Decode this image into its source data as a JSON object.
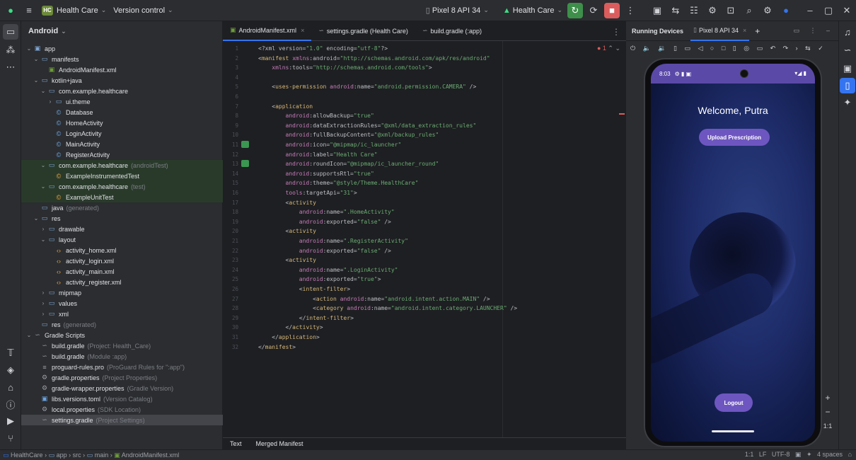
{
  "titlebar": {
    "project_badge": "HC",
    "project_name": "Health Care",
    "vcs": "Version control",
    "device": "Pixel 8 API 34",
    "run_config": "Health Care"
  },
  "project_panel": {
    "view": "Android",
    "tree": [
      {
        "label": "app",
        "dim": ""
      },
      {
        "label": "manifests",
        "dim": ""
      },
      {
        "label": "AndroidManifest.xml",
        "dim": ""
      },
      {
        "label": "kotlin+java",
        "dim": ""
      },
      {
        "label": "com.example.healthcare",
        "dim": ""
      },
      {
        "label": "ui.theme",
        "dim": ""
      },
      {
        "label": "Database",
        "dim": ""
      },
      {
        "label": "HomeActivity",
        "dim": ""
      },
      {
        "label": "LoginActivity",
        "dim": ""
      },
      {
        "label": "MainActivity",
        "dim": ""
      },
      {
        "label": "RegisterActivity",
        "dim": ""
      },
      {
        "label": "com.example.healthcare",
        "dim": "(androidTest)"
      },
      {
        "label": "ExampleInstrumentedTest",
        "dim": ""
      },
      {
        "label": "com.example.healthcare",
        "dim": "(test)"
      },
      {
        "label": "ExampleUnitTest",
        "dim": ""
      },
      {
        "label": "java",
        "dim": "(generated)"
      },
      {
        "label": "res",
        "dim": ""
      },
      {
        "label": "drawable",
        "dim": ""
      },
      {
        "label": "layout",
        "dim": ""
      },
      {
        "label": "activity_home.xml",
        "dim": ""
      },
      {
        "label": "activity_login.xml",
        "dim": ""
      },
      {
        "label": "activity_main.xml",
        "dim": ""
      },
      {
        "label": "activity_register.xml",
        "dim": ""
      },
      {
        "label": "mipmap",
        "dim": ""
      },
      {
        "label": "values",
        "dim": ""
      },
      {
        "label": "xml",
        "dim": ""
      },
      {
        "label": "res",
        "dim": "(generated)"
      },
      {
        "label": "Gradle Scripts",
        "dim": ""
      },
      {
        "label": "build.gradle",
        "dim": "(Project: Health_Care)"
      },
      {
        "label": "build.gradle",
        "dim": "(Module :app)"
      },
      {
        "label": "proguard-rules.pro",
        "dim": "(ProGuard Rules for \":app\")"
      },
      {
        "label": "gradle.properties",
        "dim": "(Project Properties)"
      },
      {
        "label": "gradle-wrapper.properties",
        "dim": "(Gradle Version)"
      },
      {
        "label": "libs.versions.toml",
        "dim": "(Version Catalog)"
      },
      {
        "label": "local.properties",
        "dim": "(SDK Location)"
      },
      {
        "label": "settings.gradle",
        "dim": "(Project Settings)"
      }
    ]
  },
  "editor": {
    "tabs": [
      {
        "label": "AndroidManifest.xml"
      },
      {
        "label": "settings.gradle (Health Care)"
      },
      {
        "label": "build.gradle (:app)"
      }
    ],
    "error_indicator": "1",
    "code": [
      "<?xml version=\"1.0\" encoding=\"utf-8\"?>",
      "<manifest xmlns:android=\"http://schemas.android.com/apk/res/android\"",
      "    xmlns:tools=\"http://schemas.android.com/tools\">",
      "",
      "    <uses-permission android:name=\"android.permission.CAMERA\" />",
      "",
      "    <application",
      "        android:allowBackup=\"true\"",
      "        android:dataExtractionRules=\"@xml/data_extraction_rules\"",
      "        android:fullBackupContent=\"@xml/backup_rules\"",
      "        android:icon=\"@mipmap/ic_launcher\"",
      "        android:label=\"Health Care\"",
      "        android:roundIcon=\"@mipmap/ic_launcher_round\"",
      "        android:supportsRtl=\"true\"",
      "        android:theme=\"@style/Theme.HealthCare\"",
      "        tools:targetApi=\"31\">",
      "        <activity",
      "            android:name=\".HomeActivity\"",
      "            android:exported=\"false\" />",
      "        <activity",
      "            android:name=\".RegisterActivity\"",
      "            android:exported=\"false\" />",
      "        <activity",
      "            android:name=\".LoginActivity\"",
      "            android:exported=\"true\">",
      "            <intent-filter>",
      "                <action android:name=\"android.intent.action.MAIN\" />",
      "                <category android:name=\"android.intent.category.LAUNCHER\" />",
      "            </intent-filter>",
      "        </activity>",
      "    </application>",
      "</manifest>"
    ],
    "bottom_tabs": [
      "Text",
      "Merged Manifest"
    ]
  },
  "devices": {
    "title": "Running Devices",
    "device_tab": "Pixel 8 API 34",
    "phone": {
      "time": "8:03",
      "welcome": "Welcome, Putra",
      "upload_button": "Upload Prescription",
      "logout_button": "Logout"
    }
  },
  "zoom": {
    "plus": "+",
    "minus": "−",
    "ratio": "1:1"
  },
  "statusbar": {
    "breadcrumb": [
      "HealthCare",
      "app",
      "src",
      "main",
      "AndroidManifest.xml"
    ],
    "position": "1:1",
    "line_ending": "LF",
    "encoding": "UTF-8",
    "indent": "4 spaces"
  }
}
